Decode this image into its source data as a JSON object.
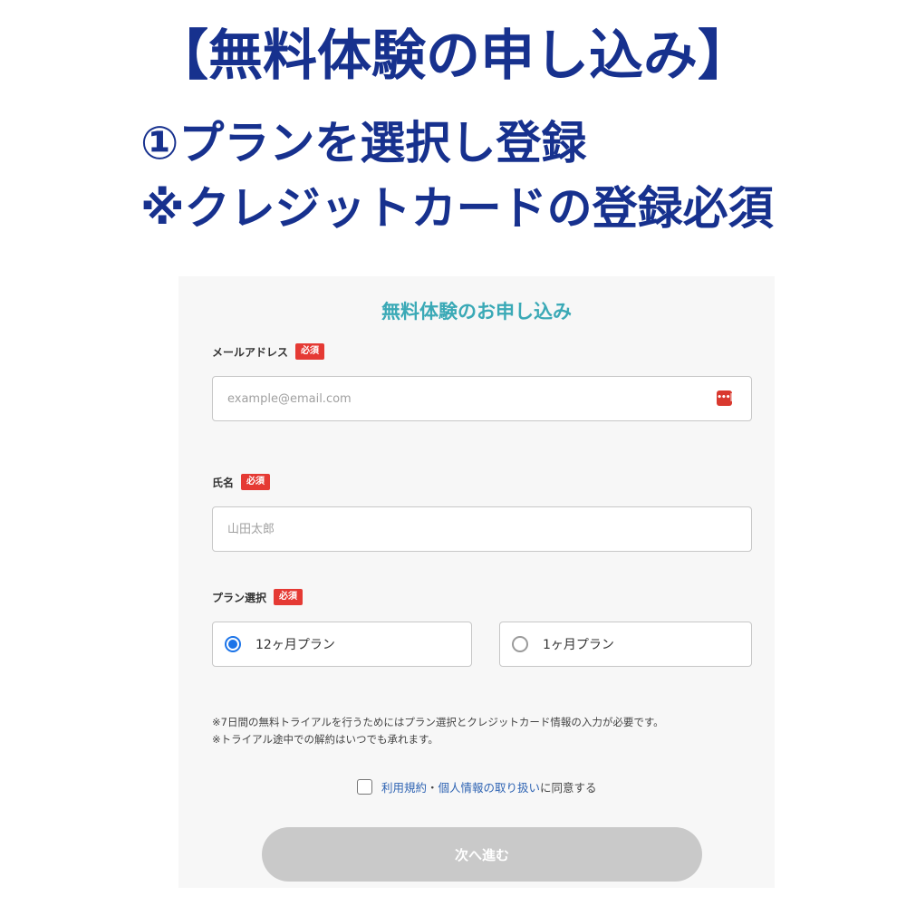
{
  "headline": {
    "title": "【無料体験の申し込み】",
    "step": "①プランを選択し登録",
    "note": "※クレジットカードの登録必須"
  },
  "form": {
    "title": "無料体験のお申し込み",
    "required_badge": "必須",
    "email": {
      "label": "メールアドレス",
      "placeholder": "example@email.com",
      "icon": "password-manager-icon"
    },
    "name": {
      "label": "氏名",
      "placeholder": "山田太郎"
    },
    "plan": {
      "label": "プラン選択",
      "options": [
        {
          "label": "12ヶ月プラン",
          "selected": true
        },
        {
          "label": "1ヶ月プラン",
          "selected": false
        }
      ]
    },
    "notice": [
      "※7日間の無料トライアルを行うためにはプラン選択とクレジットカード情報の入力が必要です。",
      "※トライアル途中での解約はいつでも承れます。"
    ],
    "agreement": {
      "terms_link": "利用規約",
      "separator": "・",
      "privacy_link": "個人情報の取り扱い",
      "suffix": "に同意する",
      "checked": false
    },
    "next_button": "次へ進む"
  },
  "colors": {
    "headline": "#17318e",
    "form_title": "#3aa9b6",
    "badge": "#e53a34",
    "radio_selected": "#1a73e8",
    "link": "#2f64b3",
    "button_disabled": "#c9c9c9"
  }
}
